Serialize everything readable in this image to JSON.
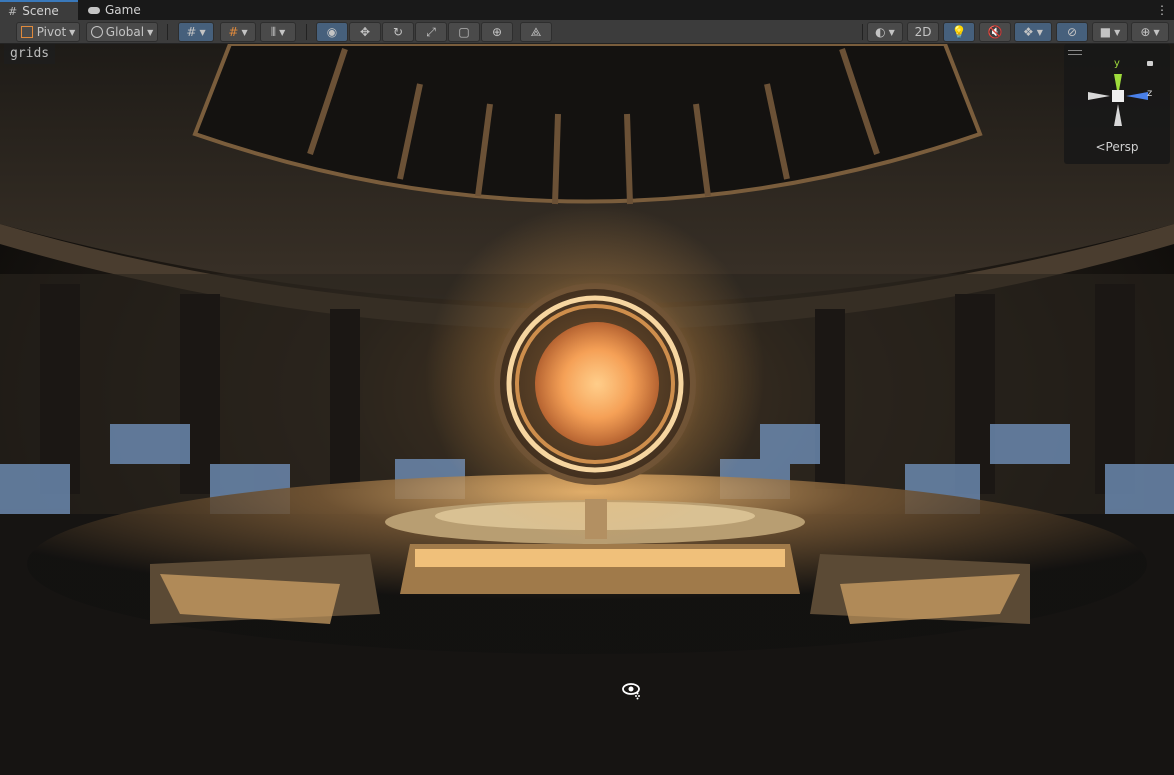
{
  "tabs": [
    {
      "label": "Scene",
      "icon": "grid-icon"
    },
    {
      "label": "Game",
      "icon": "gamepad-icon"
    }
  ],
  "toolbar": {
    "pivot_label": "Pivot",
    "global_label": "Global",
    "twod_label": "2D",
    "icons": [
      "grid-snap-icon",
      "grid-visibility-icon",
      "increment-snap-icon",
      "view-tool-icon",
      "move-tool-icon",
      "rotate-tool-icon",
      "scale-tool-icon",
      "rect-tool-icon",
      "transform-tool-icon",
      "custom-tool-icon",
      "draw-mode-icon",
      "lighting-icon",
      "audio-icon",
      "effects-icon",
      "hidden-objects-icon",
      "camera-icon",
      "gizmos-icon"
    ]
  },
  "overlay": {
    "label": "grids"
  },
  "gizmo": {
    "y_label": "y",
    "z_label": "z",
    "persp_label": "Persp",
    "colors": {
      "y": "#9fdc3c",
      "z": "#4a80e8",
      "x_neg": "#d8d8d8"
    }
  },
  "colors": {
    "accent": "#3a79bb",
    "active_tool": "#46607c",
    "portal_glow": "#ffb45a"
  }
}
